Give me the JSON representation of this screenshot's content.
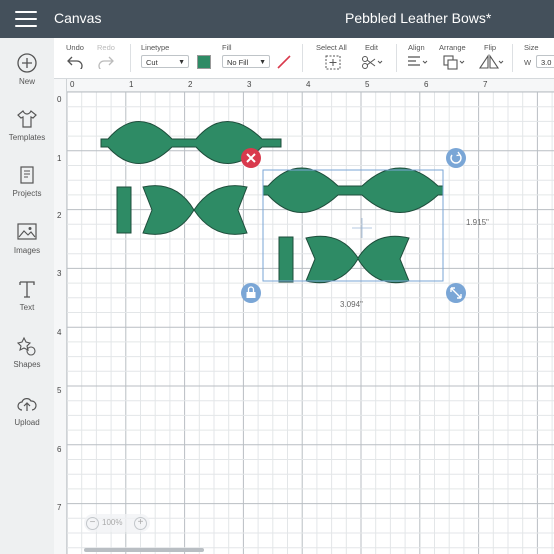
{
  "header": {
    "app_title": "Canvas",
    "project_title": "Pebbled Leather Bows*"
  },
  "sidebar": {
    "items": [
      {
        "label": "New",
        "icon": "plus-circle-icon"
      },
      {
        "label": "Templates",
        "icon": "tshirt-icon"
      },
      {
        "label": "Projects",
        "icon": "projects-icon"
      },
      {
        "label": "Images",
        "icon": "image-icon"
      },
      {
        "label": "Text",
        "icon": "text-T-icon"
      },
      {
        "label": "Shapes",
        "icon": "shapes-icon"
      },
      {
        "label": "Upload",
        "icon": "cloud-upload-icon"
      }
    ]
  },
  "toolbar": {
    "undo_label": "Undo",
    "redo_label": "Redo",
    "linetype_label": "Linetype",
    "linetype_value": "Cut",
    "fill_label": "Fill",
    "fill_value": "No Fill",
    "select_all_label": "Select All",
    "edit_label": "Edit",
    "align_label": "Align",
    "arrange_label": "Arrange",
    "flip_label": "Flip",
    "size_label": "Size",
    "width_prefix": "W",
    "width_value": "3.0"
  },
  "rulers": {
    "horizontal": [
      "0",
      "1",
      "2",
      "3",
      "4",
      "5",
      "6",
      "7"
    ],
    "vertical": [
      "0",
      "1",
      "2",
      "3",
      "4",
      "5",
      "6",
      "7"
    ]
  },
  "selection": {
    "width_label": "3.094\"",
    "height_label": "1.915\""
  },
  "zoom": {
    "level": "100%",
    "minus": "−",
    "plus": "+"
  },
  "colors": {
    "header": "#44505b",
    "shape_fill": "#2e8b65",
    "selection": "#7aa6d6",
    "delete": "#d93a4d",
    "handle": "#7aa6d6"
  }
}
